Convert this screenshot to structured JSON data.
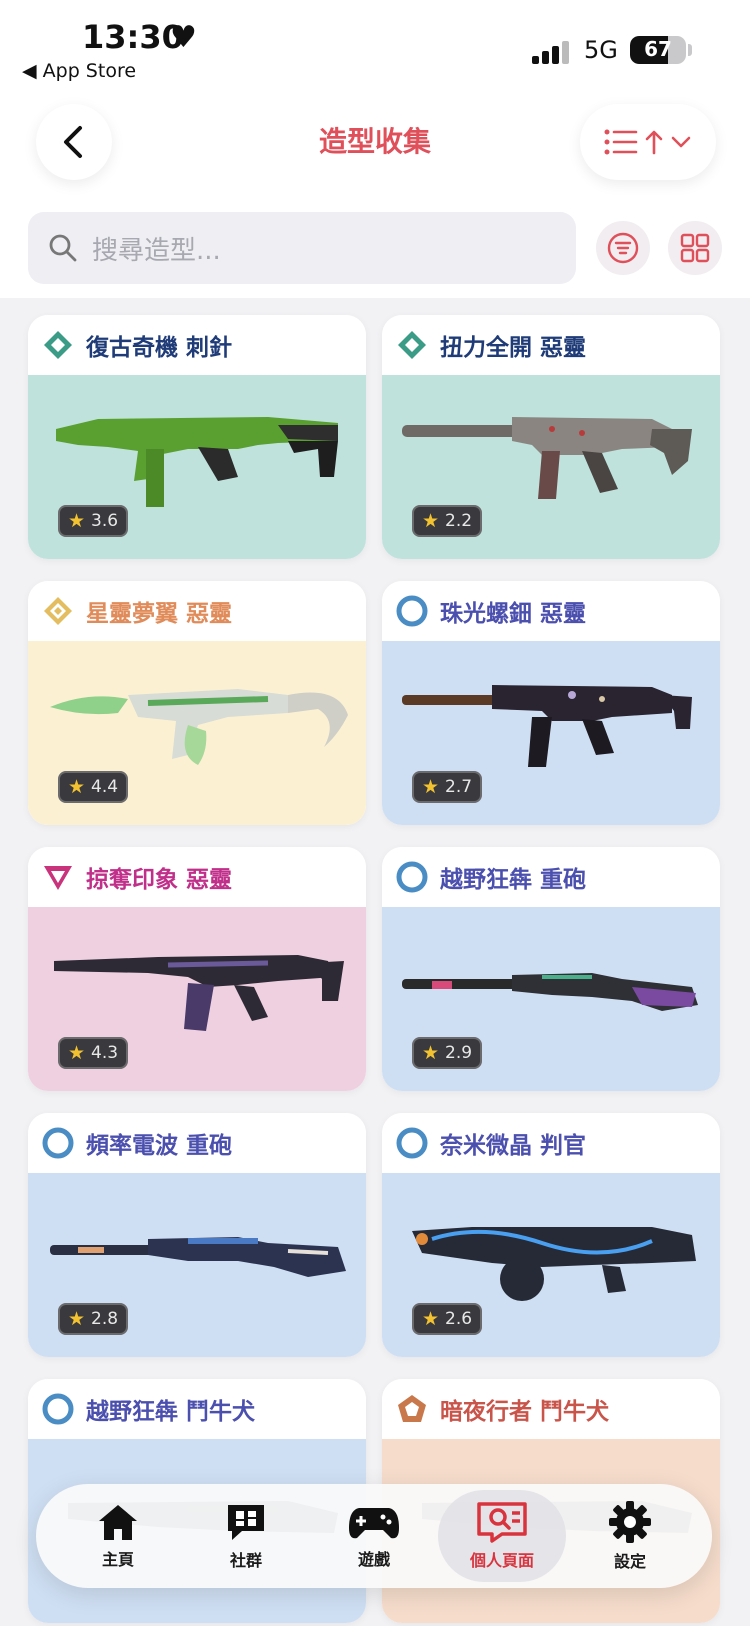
{
  "status": {
    "time": "13:30",
    "back_app": "◀ App Store",
    "network": "5G",
    "battery": "67"
  },
  "header": {
    "title": "造型收集"
  },
  "search": {
    "placeholder": "搜尋造型..."
  },
  "skins": [
    {
      "name": "復古奇機 刺針",
      "rating": "3.6",
      "tier": "select",
      "name_color": "#1f3c78",
      "bg": "#bfe2dc"
    },
    {
      "name": "扭力全開 惡靈",
      "rating": "2.2",
      "tier": "select",
      "name_color": "#1f3c78",
      "bg": "#bfe2dc"
    },
    {
      "name": "星靈夢翼 惡靈",
      "rating": "4.4",
      "tier": "exclusive",
      "name_color": "#e08b5a",
      "bg": "#fbf1d2"
    },
    {
      "name": "珠光螺鈿 惡靈",
      "rating": "2.7",
      "tier": "deluxe",
      "name_color": "#4b4fae",
      "bg": "#cfdff3"
    },
    {
      "name": "掠奪印象 惡靈",
      "rating": "4.3",
      "tier": "premium",
      "name_color": "#c0308a",
      "bg": "#efd0e0"
    },
    {
      "name": "越野狂犇 重砲",
      "rating": "2.9",
      "tier": "deluxe",
      "name_color": "#4b4fae",
      "bg": "#cfdff3"
    },
    {
      "name": "頻率電波 重砲",
      "rating": "2.8",
      "tier": "deluxe",
      "name_color": "#4b4fae",
      "bg": "#cfdff3"
    },
    {
      "name": "奈米微晶 判官",
      "rating": "2.6",
      "tier": "deluxe",
      "name_color": "#4b4fae",
      "bg": "#cfdff3"
    },
    {
      "name": "越野狂犇 鬥牛犬",
      "rating": "",
      "tier": "deluxe",
      "name_color": "#4b4fae",
      "bg": "#cfdff3"
    },
    {
      "name": "暗夜行者 鬥牛犬",
      "rating": "",
      "tier": "exclusive",
      "name_color": "#c9544a",
      "bg": "#f5dccb"
    }
  ],
  "tabs": [
    {
      "label": "主頁",
      "icon": "home-icon",
      "active": false
    },
    {
      "label": "社群",
      "icon": "community-icon",
      "active": false
    },
    {
      "label": "遊戲",
      "icon": "gamepad-icon",
      "active": false
    },
    {
      "label": "個人頁面",
      "icon": "profile-search-icon",
      "active": true
    },
    {
      "label": "設定",
      "icon": "gear-icon",
      "active": false
    }
  ],
  "colors": {
    "accent": "#e0505a",
    "tab_active": "#d9343e"
  }
}
